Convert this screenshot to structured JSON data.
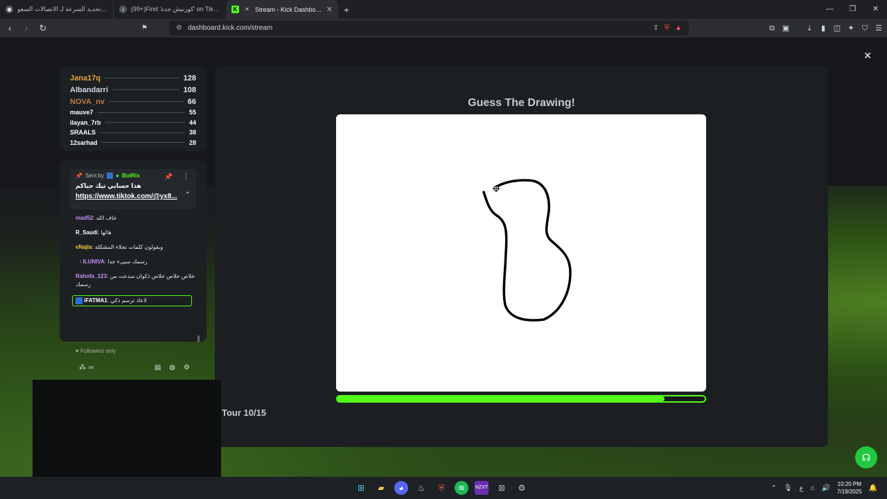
{
  "browser": {
    "tabs": [
      {
        "label": "تخطي تحديد السرعة لـ الاتصالات السعو...",
        "icon": "wave-icon",
        "active": false
      },
      {
        "label": "(99+)Find 'كورنيش جدة' on TikTok | T...",
        "icon": "tiktok-icon",
        "active": false
      },
      {
        "label": "Stream - Kick Dashboard",
        "icon": "kick-icon",
        "active": true
      }
    ],
    "new_tab": "+",
    "url": "dashboard.kick.com/stream"
  },
  "leaderboard": [
    {
      "name": "Jana17q",
      "score": "128",
      "color": "#e8a33a",
      "size": "big"
    },
    {
      "name": "Albandarri",
      "score": "108",
      "color": "#cfd7e6",
      "size": "big"
    },
    {
      "name": "NOVA_nv",
      "score": "66",
      "color": "#b87a4a",
      "size": "big"
    },
    {
      "name": "mauve7",
      "score": "55",
      "color": "#ffffff",
      "size": "small"
    },
    {
      "name": "ilayan_7rb",
      "score": "44",
      "color": "#ffffff",
      "size": "small"
    },
    {
      "name": "SRAALS",
      "score": "38",
      "color": "#ffffff",
      "size": "small"
    },
    {
      "name": "12sarhad",
      "score": "28",
      "color": "#ffffff",
      "size": "small"
    }
  ],
  "chat": {
    "pinned": {
      "sent_by_label": "Sent by",
      "sender": "BotRix",
      "message": "هذا حسابي تيك حياكم",
      "link": "https://www.tiktok.com/@yx8..."
    },
    "messages": [
      {
        "user": "mad52",
        "text": "خاف الله",
        "color": "#c98bf5"
      },
      {
        "user": "R_Saudi",
        "text": "هالها",
        "color": "#ffffff"
      },
      {
        "user": "vNajla",
        "text": "ويقولون كلمات تجلاء المشكلة",
        "color": "#f5c842"
      },
      {
        "user": "ILUNIVA",
        "text": "رسمك سيىء جدا",
        "color": "#c98bf5"
      },
      {
        "user": "Rahofa_123",
        "text": "خلاص خلاص خلاص ذكوان سدعت من رسمك",
        "color": "#c98bf5"
      },
      {
        "user": "iFATMA1",
        "text": "لاعاد ترسم ذكي",
        "color": "#ffffff",
        "highlight": true
      }
    ],
    "followers_only": "Followers only",
    "footer_left": "∞"
  },
  "game": {
    "title": "Guess The Drawing!",
    "round": "Tour 10/15",
    "progress": 0.89
  },
  "taskbar": {
    "time": "10:20 PM",
    "date": "7/19/2025",
    "lang": "ع"
  },
  "colors": {
    "accent": "#53fc18"
  }
}
